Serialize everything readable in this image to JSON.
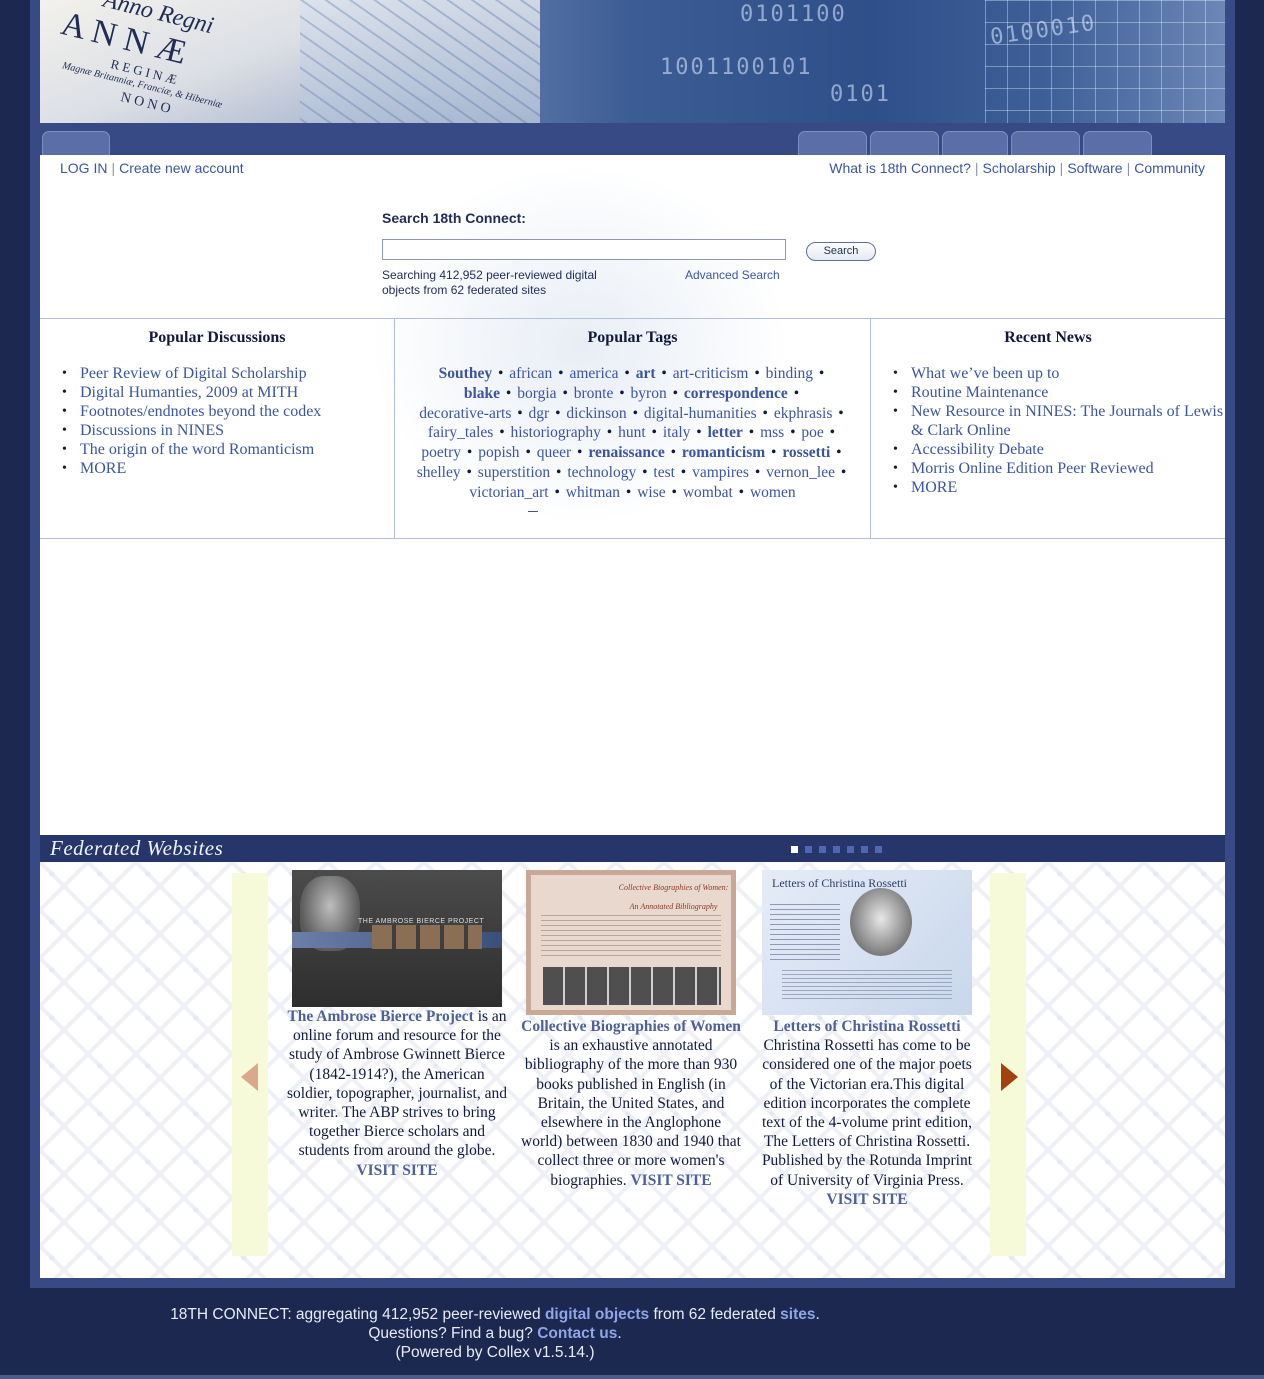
{
  "banner": {
    "anno": "Anno Regni",
    "annae": "A N N Æ",
    "regina": "R E G I N Æ",
    "magna": "Magnæ Britanniæ, Franciæ, & Hiberniæ",
    "nono": "N O N O",
    "binary_1": "0101100",
    "binary_2": "1001100101",
    "binary_3": "0101",
    "binary_4": "0100010"
  },
  "toplinks": {
    "login": "LOG IN",
    "create_account": "Create new account",
    "what_is": "What is 18th Connect?",
    "scholarship": "Scholarship",
    "software": "Software",
    "community": "Community"
  },
  "search": {
    "label": "Search 18th Connect:",
    "input_value": "",
    "button": "Search",
    "info": "Searching 412,952 peer-reviewed digital objects from 62 federated sites",
    "advanced": "Advanced Search"
  },
  "discussions": {
    "title": "Popular Discussions",
    "items": [
      "Peer Review of Digital Scholarship",
      "Digital Humanties, 2009 at MITH",
      "Footnotes/endnotes beyond the codex",
      "Discussions in NINES",
      "The origin of the word Romanticism",
      "MORE"
    ]
  },
  "tags": {
    "title": "Popular Tags",
    "items": [
      {
        "t": "Southey",
        "b": true
      },
      {
        "t": "african",
        "b": false
      },
      {
        "t": "america",
        "b": false
      },
      {
        "t": "art",
        "b": true
      },
      {
        "t": "art-criticism",
        "b": false
      },
      {
        "t": "binding",
        "b": false
      },
      {
        "t": "blake",
        "b": true
      },
      {
        "t": "borgia",
        "b": false
      },
      {
        "t": "bronte",
        "b": false
      },
      {
        "t": "byron",
        "b": false
      },
      {
        "t": "correspondence",
        "b": true
      },
      {
        "t": "decorative-arts",
        "b": false
      },
      {
        "t": "dgr",
        "b": false
      },
      {
        "t": "dickinson",
        "b": false
      },
      {
        "t": "digital-humanities",
        "b": false
      },
      {
        "t": "ekphrasis",
        "b": false
      },
      {
        "t": "fairy_tales",
        "b": false
      },
      {
        "t": "historiography",
        "b": false
      },
      {
        "t": "hunt",
        "b": false
      },
      {
        "t": "italy",
        "b": false
      },
      {
        "t": "letter",
        "b": true
      },
      {
        "t": "mss",
        "b": false
      },
      {
        "t": "poe",
        "b": false
      },
      {
        "t": "poetry",
        "b": false
      },
      {
        "t": "popish",
        "b": false
      },
      {
        "t": "queer",
        "b": false
      },
      {
        "t": "renaissance",
        "b": true
      },
      {
        "t": "romanticism",
        "b": true
      },
      {
        "t": "rossetti",
        "b": true
      },
      {
        "t": "shelley",
        "b": false
      },
      {
        "t": "superstition",
        "b": false
      },
      {
        "t": "technology",
        "b": false
      },
      {
        "t": "test",
        "b": false
      },
      {
        "t": "vampires",
        "b": false
      },
      {
        "t": "vernon_lee",
        "b": false
      },
      {
        "t": "victorian_art",
        "b": false
      },
      {
        "t": "whitman",
        "b": false
      },
      {
        "t": "wise",
        "b": false
      },
      {
        "t": "wombat",
        "b": false
      },
      {
        "t": "women",
        "b": false
      }
    ],
    "separator": "•"
  },
  "news": {
    "title": "Recent News",
    "items": [
      "What we’ve been up to",
      "Routine Maintenance",
      "New Resource in NINES: The Journals of Lewis & Clark Online",
      "Accessibility Debate",
      "Morris Online Edition Peer Reviewed",
      "MORE"
    ]
  },
  "federated": {
    "title": "Federated Websites",
    "dots": 7,
    "active_dot": 0,
    "visit": "VISIT SITE",
    "sites": [
      {
        "name": "The Ambrose Bierce Project",
        "desc": " is an online forum and resource for the study of Ambrose Gwinnett Bierce (1842-1914?), the American soldier, topographer, journalist, and writer. The ABP strives to bring together Bierce scholars and students from around the globe. ",
        "thumb_caption": "THE AMBROSE BIERCE PROJECT"
      },
      {
        "name": "Collective Biographies of Women",
        "desc": " is an exhaustive annotated bibliography of the more than 930 books published in English (in Britain, the United States, and elsewhere in the Anglophone world) between 1830 and 1940 that collect three or more women's biographies. ",
        "thumb_caption": "Collective Biographies of Women: An Annotated Bibliography"
      },
      {
        "name": "Letters of Christina Rossetti",
        "desc": "Christina Rossetti has come to be considered one of the major poets of the Victorian era.This digital edition incorporates the complete text of the 4-volume print edition, The Letters of Christina Rossetti. Published by the Rotunda Imprint of University of Virginia Press. ",
        "thumb_caption": "Letters of Christina Rossetti"
      }
    ]
  },
  "footer": {
    "line1_a": "18TH CONNECT:  aggregating 412,952 peer-reviewed ",
    "line1_link1": "digital objects",
    "line1_b": " from 62 federated ",
    "line1_link2": "sites",
    "line1_c": ".",
    "line2_a": "Questions? Find a bug? ",
    "line2_link": "Contact us",
    "line2_b": ".",
    "line3": "(Powered by Collex v1.5.14.)"
  },
  "colors": {
    "background": "#1c2850",
    "frame": "#374a85",
    "link": "#3b55a0",
    "dark_text": "#111a3a",
    "bar": "#26366a",
    "arrow_panel": "#f6fad8",
    "arrow_left": "#d9a98a",
    "arrow_right": "#a2400e"
  }
}
